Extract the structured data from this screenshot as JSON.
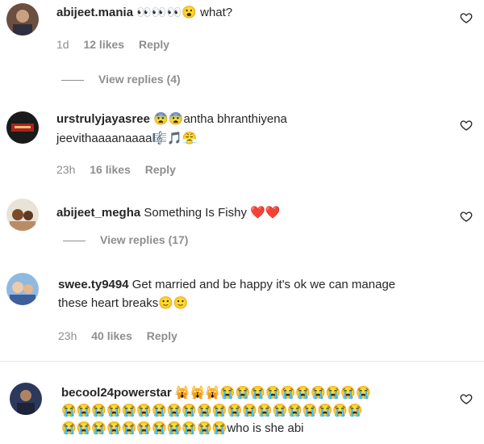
{
  "comments": [
    {
      "username": "abijeet.mania",
      "text_emojis": "👀👀👀😮",
      "text": "what?",
      "time": "1d",
      "likes": "12 likes",
      "reply": "Reply",
      "view_replies": "View replies (4)"
    },
    {
      "username": "urstrulyjayasree",
      "text_emojis": "😨😨",
      "text": "antha bhranthiyena",
      "line2": "jeevithaaaanaaaa",
      "line2_emojis": "🎼🎵😤",
      "time": "23h",
      "likes": "16 likes",
      "reply": "Reply"
    },
    {
      "username": "abijeet_megha",
      "text": "Something Is Fishy",
      "text_emojis": "❤️❤️",
      "view_replies": "View replies (17)"
    },
    {
      "username": "swee.ty9494",
      "text": "Get married and be happy it's ok we can manage",
      "line2": "these heart breaks",
      "line2_emojis": "🙂🙂",
      "time": "23h",
      "likes": "40 likes",
      "reply": "Reply"
    },
    {
      "username": "becool24powerstar",
      "text_emojis": "🙀🙀🙀😭😭😭😭😭😭😭😭😭😭",
      "line2_emojis": "😭😭😭😭😭😭😭😭😭😭😭😭😭😭😭😭😭😭😭😭",
      "line3_emojis": "😭😭😭😭😭😭😭😭😭😭😭",
      "line3_text": "who is she abi"
    }
  ],
  "icons": {
    "like": "heart-outline-icon"
  },
  "colors": {
    "muted": "#8e8e8e",
    "text": "#262626"
  }
}
